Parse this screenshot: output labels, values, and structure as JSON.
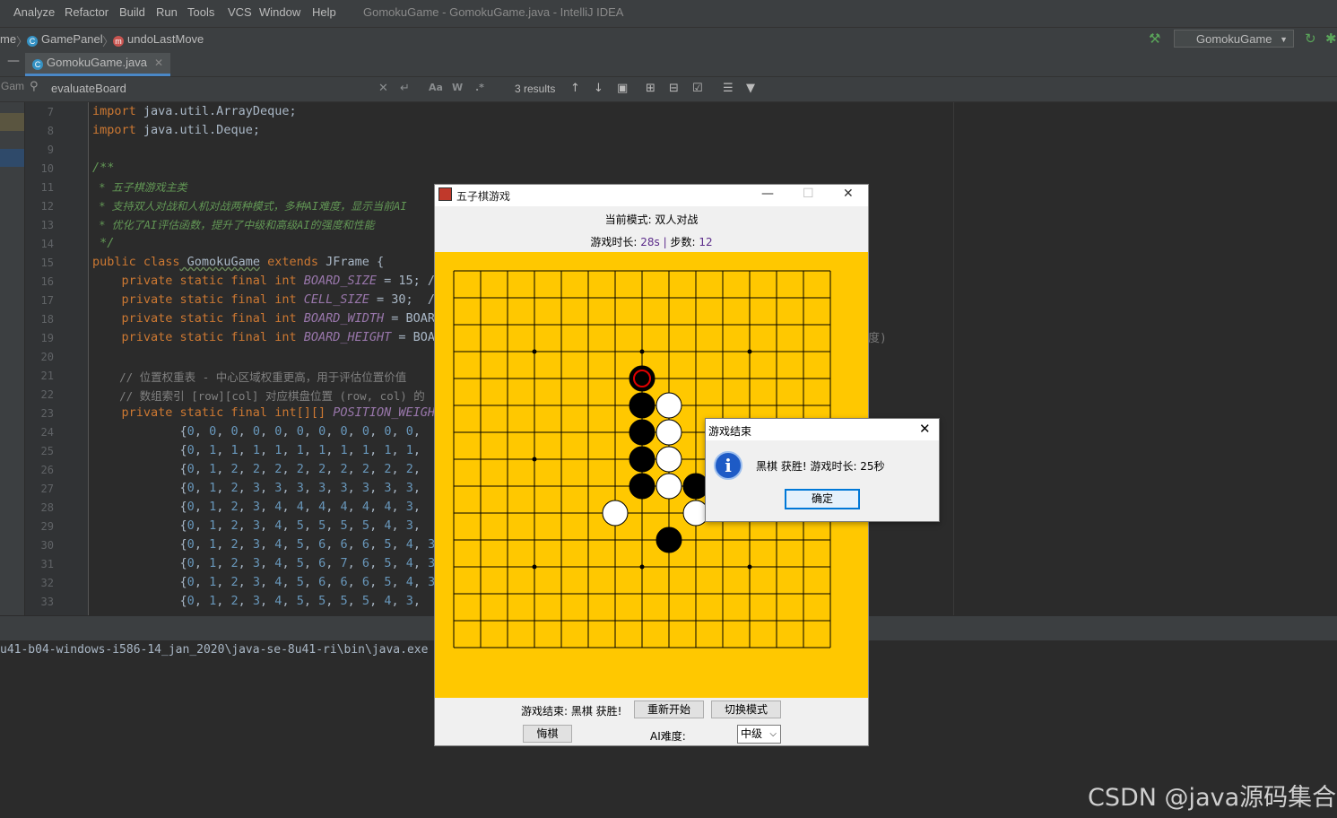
{
  "menubar": {
    "items": [
      "Analyze",
      "Refactor",
      "Build",
      "Run",
      "Tools",
      "VCS",
      "Window",
      "Help"
    ],
    "window_title": "GomokuGame - GomokuGame.java - IntelliJ IDEA"
  },
  "navbar": {
    "crumb_fragment": "me",
    "crumbs": [
      "GamePanel",
      "undoLastMove"
    ],
    "run_config": "GomokuGame"
  },
  "tabs": {
    "left_fragment": "Gam",
    "active": "GomokuGame.java"
  },
  "search": {
    "value": "evaluateBoard",
    "results": "3 results"
  },
  "editor": {
    "line_numbers": [
      "7",
      "8",
      "9",
      "10",
      "11",
      "12",
      "13",
      "14",
      "15",
      "16",
      "17",
      "18",
      "19",
      "20",
      "21",
      "22",
      "23",
      "24",
      "25",
      "26",
      "27",
      "28",
      "29",
      "30",
      "31",
      "32",
      "33"
    ],
    "lines": {
      "l7_kw": "import",
      "l7_rest": " java.util.ArrayDeque;",
      "l8_kw": "import",
      "l8_rest": " java.util.Deque;",
      "l10": "/**",
      "l11": " * 五子棋游戏主类",
      "l12": " * 支持双人对战和人机对战两种模式，多种AI难度，显示当前AI",
      "l13": " * 优化了AI评估函数，提升了中级和高级AI的强度和性能",
      "l14": " */",
      "l15_kw": "public class",
      "l15_name": " GomokuGame",
      "l15_kw2": " extends",
      "l15_rest": " JFrame {",
      "decl_prefix": "    private static final int ",
      "l16_const": "BOARD_SIZE",
      "l16_rest": " = 15; //",
      "l17_const": "CELL_SIZE",
      "l17_rest": " = 30;  //",
      "l18_const": "BOARD_WIDTH",
      "l18_rest": " = BOARD",
      "l19_const": "BOARD_HEIGHT",
      "l19_rest": " = BOAR",
      "l21": "    // 位置权重表 - 中心区域权重更高，用于评估位置价值",
      "l22": "    // 数组索引 [row][col] 对应棋盘位置 (row, col) 的",
      "l23_kw": "    private static final int[][]",
      "l23_const": " POSITION_WEIGHT",
      "rows": [
        "            {0, 0, 0, 0, 0, 0, 0, 0, 0, 0, 0,",
        "            {0, 1, 1, 1, 1, 1, 1, 1, 1, 1, 1,",
        "            {0, 1, 2, 2, 2, 2, 2, 2, 2, 2, 2,",
        "            {0, 1, 2, 3, 3, 3, 3, 3, 3, 3, 3,",
        "            {0, 1, 2, 3, 4, 4, 4, 4, 4, 4, 3,",
        "            {0, 1, 2, 3, 4, 5, 5, 5, 5, 4, 3,",
        "            {0, 1, 2, 3, 4, 5, 6, 6, 6, 5, 4, 3,",
        "            {0, 1, 2, 3, 4, 5, 6, 7, 6, 5, 4, 3,",
        "            {0, 1, 2, 3, 4, 5, 6, 6, 6, 5, 4, 3,",
        "            {0, 1, 2, 3, 4, 5, 5, 5, 5, 4, 3,"
      ]
    },
    "right_fragment": "度)"
  },
  "console": {
    "line": "u41-b04-windows-i586-14_jan_2020\\java-se-8u41-ri\\bin\\java.exe"
  },
  "watermark": "CSDN @java源码集合",
  "game": {
    "title": "五子棋游戏",
    "mode_label": "当前模式: 双人对战",
    "time_label": "游戏时长: ",
    "time_value": "28s",
    "separator": " | ",
    "steps_label": "步数: ",
    "steps_value": "12",
    "board_size": 15,
    "stones": [
      {
        "row": 4,
        "col": 7,
        "color": "black",
        "last": true
      },
      {
        "row": 5,
        "col": 7,
        "color": "black"
      },
      {
        "row": 5,
        "col": 8,
        "color": "white"
      },
      {
        "row": 6,
        "col": 7,
        "color": "black"
      },
      {
        "row": 6,
        "col": 8,
        "color": "white"
      },
      {
        "row": 7,
        "col": 7,
        "color": "black"
      },
      {
        "row": 7,
        "col": 8,
        "color": "white"
      },
      {
        "row": 8,
        "col": 7,
        "color": "black"
      },
      {
        "row": 8,
        "col": 8,
        "color": "white"
      },
      {
        "row": 8,
        "col": 9,
        "color": "black"
      },
      {
        "row": 9,
        "col": 6,
        "color": "white"
      },
      {
        "row": 9,
        "col": 9,
        "color": "white"
      },
      {
        "row": 10,
        "col": 8,
        "color": "black"
      }
    ],
    "star_points": [
      [
        3,
        3
      ],
      [
        3,
        7
      ],
      [
        3,
        11
      ],
      [
        7,
        3
      ],
      [
        7,
        11
      ],
      [
        11,
        3
      ],
      [
        11,
        7
      ],
      [
        11,
        11
      ]
    ],
    "status": "游戏结束: 黑棋 获胜!",
    "restart_label": "重新开始",
    "switch_mode_label": "切换模式",
    "undo_label": "悔棋",
    "ai_label": "AI难度:",
    "difficulty": "中级",
    "colors": {
      "board": "#ffc800",
      "last_move": "#e00000"
    }
  },
  "dialog": {
    "title": "游戏结束",
    "message": "黑棋 获胜! 游戏时长: 25秒",
    "ok_label": "确定"
  }
}
